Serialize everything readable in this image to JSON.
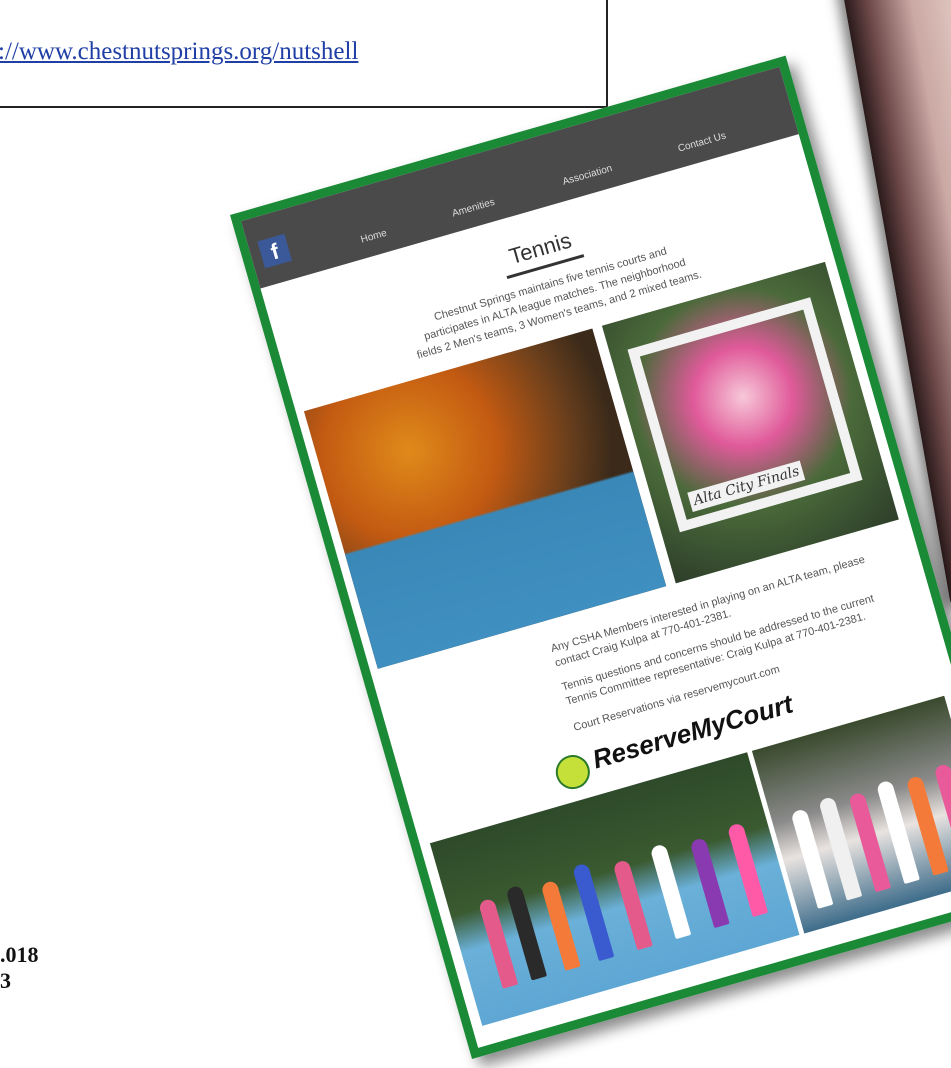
{
  "header": {
    "url_text": "://www.chestnutsprings.org/nutshell"
  },
  "footer": {
    "line1": ".018",
    "line2": "3"
  },
  "site": {
    "nav": {
      "facebook_glyph": "f",
      "items": [
        "Home",
        "Amenities",
        "Association",
        "Contact Us"
      ]
    },
    "title": "Tennis",
    "intro": "Chestnut Springs maintains five tennis courts and participates in ALTA league matches. The neighborhood fields 2 Men's teams, 3 Women's teams, and 2 mixed teams.",
    "sign_text": "Alta City Finals",
    "info": [
      "Any CSHA Members interested in playing on an ALTA team, please contact Craig Kulpa at 770-401-2381.",
      "Tennis questions and concerns should be addressed to the current Tennis Committee representative: Craig Kulpa at 770-401-2381.",
      "Court Reservations via reservemycourt.com"
    ],
    "logo_text": "ReserveMyCourt"
  },
  "colors": {
    "card_border": "#1b8a36",
    "navbar": "#4a4a4a",
    "link": "#1f3fa6"
  }
}
